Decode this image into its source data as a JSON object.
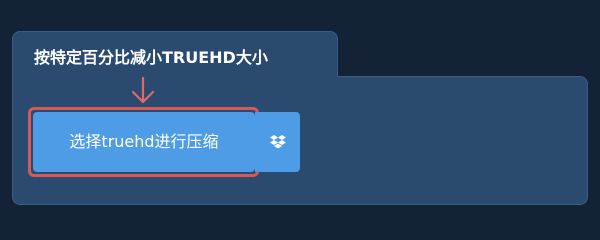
{
  "tab": {
    "title": "按特定百分比减小TRUEHD大小"
  },
  "actions": {
    "main_button_label": "选择truehd进行压缩",
    "dropbox_icon": "dropbox-icon"
  },
  "colors": {
    "background": "#132237",
    "panel": "#2b4a6f",
    "button": "#4e9ce6",
    "highlight": "#d45a5a"
  }
}
